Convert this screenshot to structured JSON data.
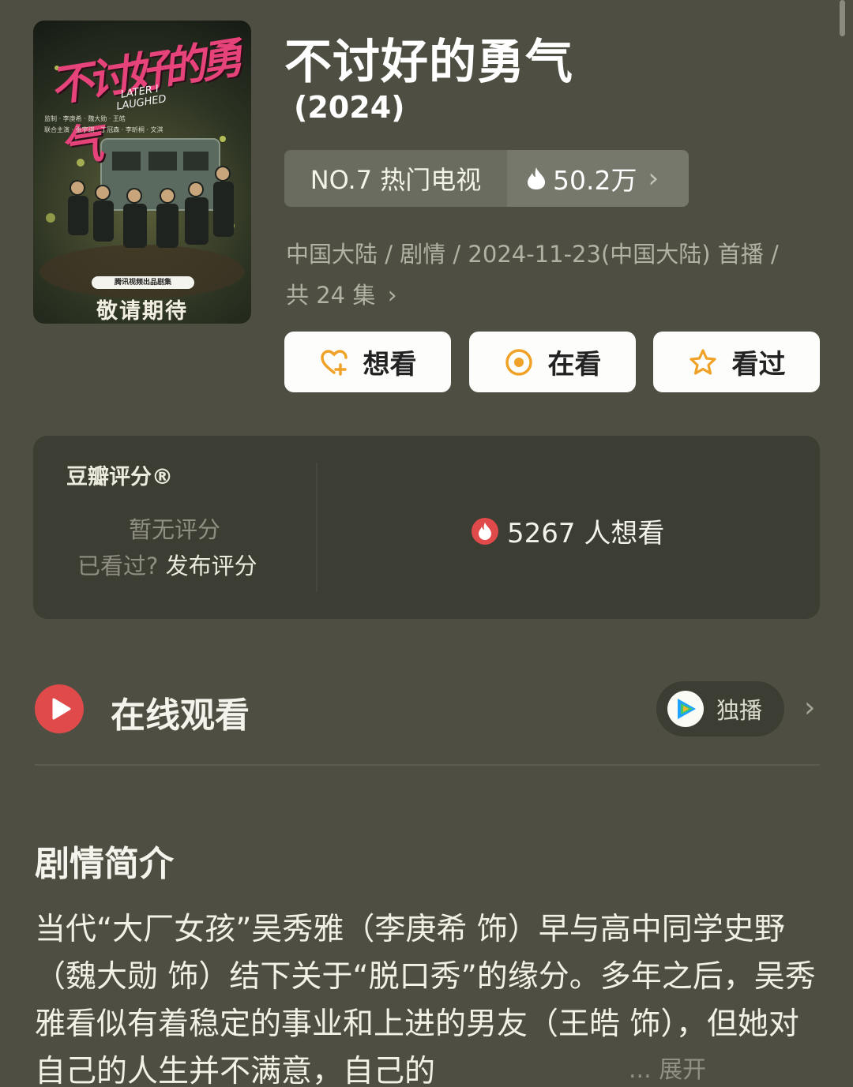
{
  "show": {
    "poster": {
      "title_art": "不讨好的勇气",
      "english_title": "LATER I LAUGHED",
      "credit_lines": [
        "监制 · 李庚希 · 魏大勋 · 王皓",
        "联合主演 · 张宇琪 · 丁冠森 · 李昕桐 · 文淇"
      ],
      "badge": "腾讯视频出品剧集",
      "bottom_text": "敬请期待"
    },
    "title": "不讨好的勇气",
    "year": "(2024)",
    "rank": {
      "label": "NO.7 热门电视",
      "heat": "50.2万"
    },
    "meta_line1": "中国大陆 / 剧情 / 2024-11-23(中国大陆) 首播 /",
    "meta_line2": "共 24 集"
  },
  "actions": {
    "want": "想看",
    "watching": "在看",
    "watched": "看过"
  },
  "rating": {
    "brand": "豆瓣评分®",
    "no_rating": "暂无评分",
    "watched_prompt": "已看过?",
    "publish": "发布评分",
    "want_count": "5267 人想看"
  },
  "online": {
    "title": "在线观看",
    "exclusive": "独播"
  },
  "synopsis": {
    "heading": "剧情简介",
    "text": "当代“大厂女孩”吴秀雅（李庚希 饰）早与高中同学史野（魏大勋 饰）结下关于“脱口秀”的缘分。多年之后，吴秀雅看似有着稳定的事业和上进的男友（王皓 饰），但她对自己的人生并不满意，自己的",
    "more": "... 展开"
  },
  "colors": {
    "background": "#4e4f42",
    "card": "#3c3d33",
    "accent_red": "#e04a4a",
    "icon_orange": "#f0a228"
  }
}
